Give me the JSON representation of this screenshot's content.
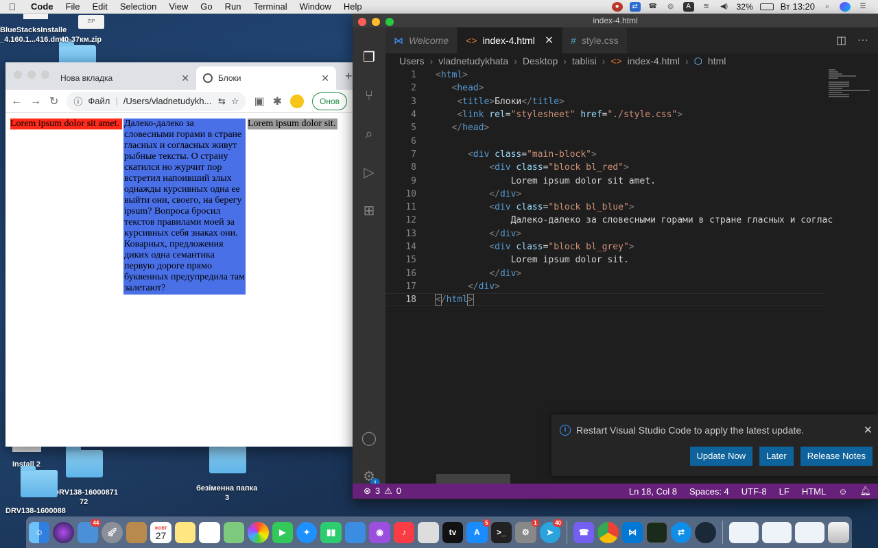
{
  "menubar": {
    "app_name": "Code",
    "items": [
      "File",
      "Edit",
      "Selection",
      "View",
      "Go",
      "Run",
      "Terminal",
      "Window",
      "Help"
    ],
    "battery": "32%",
    "clock": "Вт 13:20"
  },
  "desktop": {
    "labels": {
      "bluestacks": "BlueStacksInstalle",
      "dmg_line": "_4.160.1...416.dmg",
      "zip": "40-37км.zip",
      "install2": "Install 2",
      "drv_a": "DRV138-16000871",
      "drv_a2": "72",
      "folder_new": "безіменна папка",
      "folder_new2": "3",
      "drv_b": "DRV138-1600088"
    }
  },
  "chrome": {
    "tabs": [
      {
        "label": "Нова вкладка"
      },
      {
        "label": "Блоки"
      }
    ],
    "address": {
      "scheme_label": "Файл",
      "url": "/Users/vladnetudykh..."
    },
    "update_label": "Онов",
    "page": {
      "red": "Lorem ipsum dolor sit amet.",
      "blue": "Далеко-далеко за словесными горами в стране гласных и согласных живут рыбные тексты. О страну скатился но журчит пор встретил напоивший злых однажды курсивных одна ее выйти они, своего, на берегу ipsum? Вопроса бросил текстов правилами моей за курсивных себя знаках они. Коварных, предложения диких одна семантика первую дороге прямо буквенных предупредила там залетают?",
      "grey": "Lorem ipsum dolor sit."
    }
  },
  "vscode": {
    "window_title": "index-4.html",
    "tabs": [
      {
        "label": "Welcome"
      },
      {
        "label": "index-4.html"
      },
      {
        "label": "style.css"
      }
    ],
    "breadcrumb": [
      "Users",
      "vladnetudykhata",
      "Desktop",
      "tablisi",
      "index-4.html",
      "html"
    ],
    "code_lines": [
      "1",
      "2",
      "3",
      "4",
      "5",
      "6",
      "7",
      "8",
      "9",
      "10",
      "11",
      "12",
      "13",
      "14",
      "15",
      "16",
      "17",
      "18"
    ],
    "code": {
      "l9": "Lorem ipsum dolor sit amet.",
      "l12": "Далеко-далеко за словесными горами в стране гласных и соглас",
      "l15": "Lorem ipsum dolor sit.",
      "title_text": "Блоки",
      "stylesheet_rel": "\"stylesheet\"",
      "stylesheet_href": "\"./style.css\"",
      "main_block": "\"main-block\"",
      "bl_red": "\"block bl_red\"",
      "bl_blue": "\"block bl_blue\"",
      "bl_grey": "\"block bl_grey\""
    },
    "settings_badge": "1",
    "notification": {
      "message": "Restart Visual Studio Code to apply the latest update.",
      "buttons": [
        "Update Now",
        "Later",
        "Release Notes"
      ]
    },
    "status": {
      "errors": "3",
      "warnings": "0",
      "position": "Ln 18, Col 8",
      "spaces": "Spaces: 4",
      "encoding": "UTF-8",
      "eol": "LF",
      "language": "HTML"
    },
    "accent_color": "#68217a"
  },
  "dock": {
    "calendar_month": "ЖОВТ",
    "calendar_day": "27",
    "badges": {
      "mail": "44",
      "appstore": "5",
      "sysprefs": "1",
      "telegram": "40"
    }
  }
}
